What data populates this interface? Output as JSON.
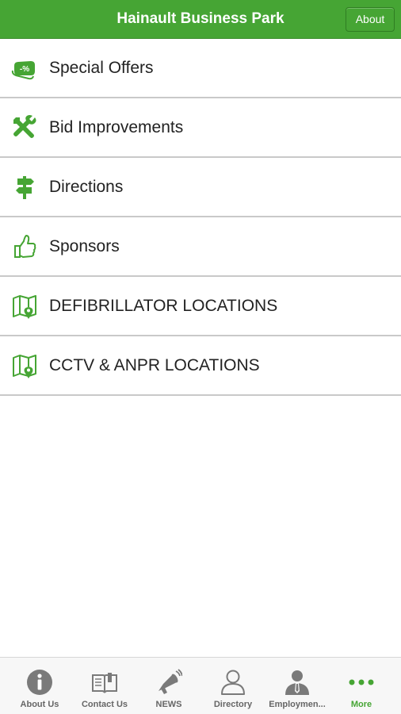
{
  "colors": {
    "accent": "#46a534",
    "text": "#222222",
    "divider": "#c9c9c9",
    "tab_inactive": "#666666"
  },
  "header": {
    "title": "Hainault Business Park",
    "about_label": "About"
  },
  "menu": {
    "items": [
      {
        "label": "Special Offers",
        "icon": "discount-tag-icon"
      },
      {
        "label": "Bid Improvements",
        "icon": "wrench-screwdriver-icon"
      },
      {
        "label": "Directions",
        "icon": "signpost-icon"
      },
      {
        "label": "Sponsors",
        "icon": "thumbs-up-icon"
      },
      {
        "label": "DEFIBRILLATOR LOCATIONS",
        "icon": "map-pin-icon"
      },
      {
        "label": "CCTV & ANPR LOCATIONS",
        "icon": "map-pin-icon"
      }
    ]
  },
  "tabbar": {
    "tabs": [
      {
        "label": "About Us",
        "icon": "info-icon",
        "active": false
      },
      {
        "label": "Contact Us",
        "icon": "book-icon",
        "active": false
      },
      {
        "label": "NEWS",
        "icon": "megaphone-icon",
        "active": false
      },
      {
        "label": "Directory",
        "icon": "person-outline-icon",
        "active": false
      },
      {
        "label": "Employmen...",
        "icon": "businessman-icon",
        "active": false
      },
      {
        "label": "More",
        "icon": "more-dots-icon",
        "active": true
      }
    ]
  }
}
